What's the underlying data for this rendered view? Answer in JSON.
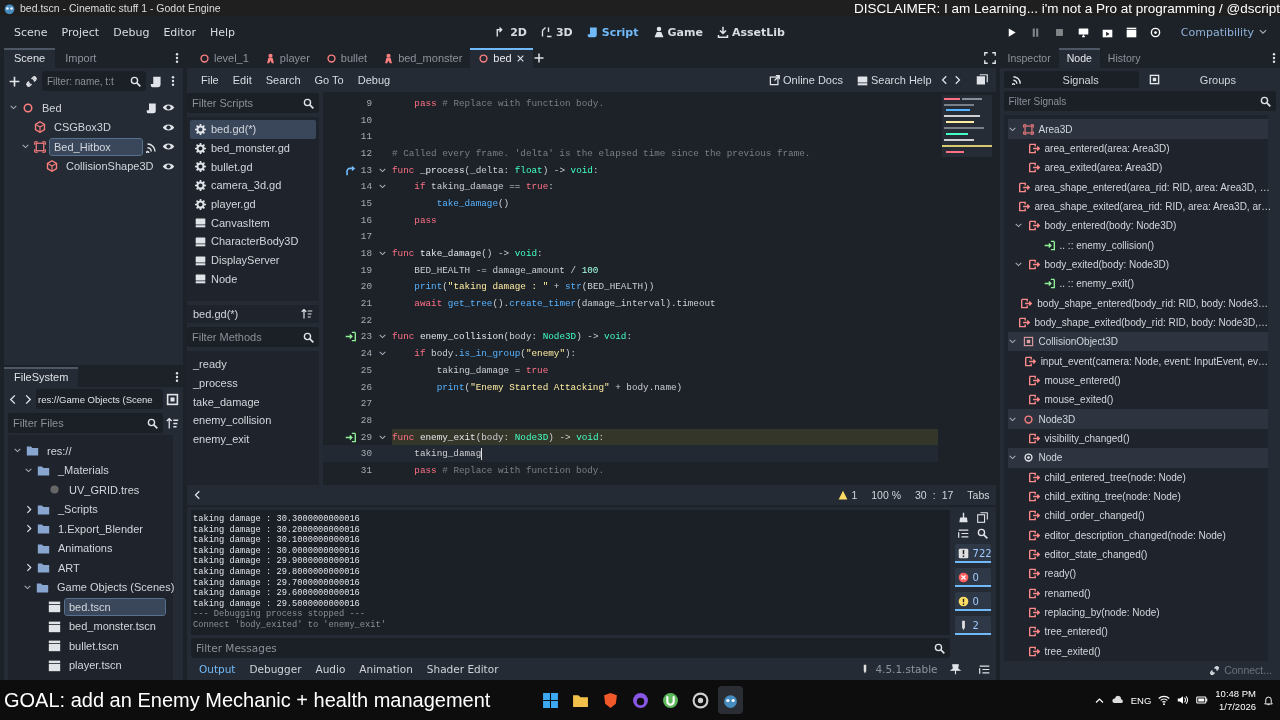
{
  "window": {
    "title": "bed.tscn - Cinematic stuff 1 - Godot Engine"
  },
  "overlay_text": "DISCLAIMER: I am Learning... i'm not a Pro at programming / @dscript",
  "menu": [
    "Scene",
    "Project",
    "Debug",
    "Editor",
    "Help"
  ],
  "workspaces": [
    {
      "label": "2D",
      "kind": "flat",
      "selected": false
    },
    {
      "label": "3D",
      "kind": "spatial",
      "selected": false
    },
    {
      "label": "Script",
      "kind": "script",
      "selected": true
    },
    {
      "label": "Game",
      "kind": "game",
      "selected": false
    },
    {
      "label": "AssetLib",
      "kind": "assetlib",
      "selected": false
    }
  ],
  "run_buttons": [
    {
      "kind": "play",
      "disabled": false
    },
    {
      "kind": "pause",
      "disabled": true
    },
    {
      "kind": "stop",
      "disabled": true
    },
    {
      "kind": "remote",
      "disabled": false
    },
    {
      "kind": "scene",
      "disabled": false
    },
    {
      "kind": "custom",
      "disabled": false
    },
    {
      "kind": "movie",
      "disabled": false
    }
  ],
  "renderer": "Compatibility",
  "scene_dock": {
    "tabs": [
      {
        "label": "Scene",
        "selected": true
      },
      {
        "label": "Import",
        "selected": false
      }
    ],
    "filter": {
      "placeholder": "Filter: name, t:t"
    },
    "tree": [
      {
        "label": "Bed",
        "kind": "node3d",
        "has_script": true,
        "has_signals": false,
        "visible": true,
        "selected": false,
        "expanded": true,
        "children": [
          {
            "label": "CSGBox3D",
            "kind": "csg",
            "has_script": false,
            "has_signals": false,
            "visible": true,
            "selected": false
          },
          {
            "label": "Bed_Hitbox",
            "kind": "area",
            "has_script": false,
            "has_signals": true,
            "visible": true,
            "selected": true,
            "expanded": true,
            "children": [
              {
                "label": "CollisionShape3D",
                "kind": "shape",
                "has_script": false,
                "has_signals": false,
                "visible": true,
                "selected": false
              }
            ]
          }
        ]
      }
    ]
  },
  "filesystem": {
    "title": "FileSystem",
    "path": "res://Game Objects (Scene",
    "filter": {
      "placeholder": "Filter Files"
    },
    "tree": [
      {
        "label": "res://",
        "kind": "folder",
        "expanded": true,
        "selected": false,
        "children": [
          {
            "label": "_Materials",
            "kind": "folder",
            "expanded": true,
            "selected": false,
            "children": [
              {
                "label": "UV_GRID.tres",
                "kind": "resource",
                "selected": false
              }
            ]
          },
          {
            "label": "_Scripts",
            "kind": "folder",
            "expanded": false,
            "selected": false
          },
          {
            "label": "1.Export_Blender",
            "kind": "folder",
            "expanded": false,
            "selected": false
          },
          {
            "label": "Animations",
            "kind": "folder",
            "selected": false
          },
          {
            "label": "ART",
            "kind": "folder",
            "expanded": false,
            "selected": false
          },
          {
            "label": "Game Objects (Scenes)",
            "kind": "folder",
            "expanded": true,
            "selected": false,
            "children": [
              {
                "label": "bed.tscn",
                "kind": "scene",
                "selected": true
              },
              {
                "label": "bed_monster.tscn",
                "kind": "scene",
                "selected": false
              },
              {
                "label": "bullet.tscn",
                "kind": "scene",
                "selected": false
              },
              {
                "label": "player.tscn",
                "kind": "scene",
                "selected": false
              }
            ]
          }
        ]
      }
    ]
  },
  "editor_tabs": [
    {
      "label": "level_1",
      "kind": "node3d",
      "selected": false
    },
    {
      "label": "player",
      "kind": "character",
      "selected": false
    },
    {
      "label": "bullet",
      "kind": "node3d",
      "selected": false
    },
    {
      "label": "bed_monster",
      "kind": "character",
      "selected": false
    },
    {
      "label": "bed",
      "kind": "node3d",
      "selected": true
    }
  ],
  "script_menu": [
    "File",
    "Edit",
    "Search",
    "Go To",
    "Debug"
  ],
  "help_links": [
    {
      "label": "Online Docs",
      "kind": "docs"
    },
    {
      "label": "Search Help",
      "kind": "help"
    }
  ],
  "scripts": {
    "filter": {
      "placeholder": "Filter Scripts"
    },
    "items": [
      {
        "label": "bed.gd(*)",
        "kind": "script",
        "selected": true
      },
      {
        "label": "bed_monster.gd",
        "kind": "script",
        "selected": false
      },
      {
        "label": "bullet.gd",
        "kind": "script",
        "selected": false
      },
      {
        "label": "camera_3d.gd",
        "kind": "script",
        "selected": false
      },
      {
        "label": "player.gd",
        "kind": "script",
        "selected": false
      },
      {
        "label": "CanvasItem",
        "kind": "doc",
        "selected": false
      },
      {
        "label": "CharacterBody3D",
        "kind": "doc",
        "selected": false
      },
      {
        "label": "DisplayServer",
        "kind": "doc",
        "selected": false
      },
      {
        "label": "Node",
        "kind": "doc",
        "selected": false
      }
    ],
    "current": "bed.gd(*)"
  },
  "methods": {
    "filter": {
      "placeholder": "Filter Methods"
    },
    "items": [
      "_ready",
      "_process",
      "take_damage",
      "enemy_collision",
      "enemy_exit"
    ]
  },
  "code": {
    "lines": [
      {
        "n": "9",
        "kind": "plain",
        "fold": false,
        "marked": false,
        "current": false,
        "caret": false,
        "tokens": [
          {
            "kind": "kw",
            "text": "    pass"
          },
          {
            "kind": "comment",
            "text": " # Replace with function body."
          }
        ]
      },
      {
        "n": "10",
        "kind": "plain",
        "fold": false,
        "marked": false,
        "current": false,
        "caret": false
      },
      {
        "n": "11",
        "kind": "plain",
        "fold": false,
        "marked": false,
        "current": false,
        "caret": false
      },
      {
        "n": "12",
        "kind": "plain",
        "fold": false,
        "marked": false,
        "current": false,
        "caret": false,
        "tokens": [
          {
            "kind": "comment",
            "text": "# Called every frame. 'delta' is the elapsed time since the previous frame."
          }
        ]
      },
      {
        "n": "13",
        "kind": "override",
        "fold": true,
        "marked": false,
        "current": false,
        "caret": false,
        "tokens": [
          {
            "kind": "kw",
            "text": "func"
          },
          {
            "kind": "name",
            "text": " _process"
          },
          {
            "kind": "plain",
            "text": "(_delta: "
          },
          {
            "kind": "type",
            "text": "float"
          },
          {
            "kind": "plain",
            "text": ") -> "
          },
          {
            "kind": "type",
            "text": "void"
          },
          {
            "kind": "plain",
            "text": ":"
          }
        ]
      },
      {
        "n": "14",
        "kind": "plain",
        "fold": true,
        "marked": false,
        "current": false,
        "caret": false,
        "tokens": [
          {
            "kind": "kw",
            "text": "    if"
          },
          {
            "kind": "plain",
            "text": " taking_damage == "
          },
          {
            "kind": "kw",
            "text": "true"
          },
          {
            "kind": "plain",
            "text": ":"
          }
        ]
      },
      {
        "n": "15",
        "kind": "plain",
        "fold": false,
        "marked": false,
        "current": false,
        "caret": false,
        "tokens": [
          {
            "kind": "call",
            "text": "        take_damage"
          },
          {
            "kind": "plain",
            "text": "()"
          }
        ]
      },
      {
        "n": "16",
        "kind": "plain",
        "fold": false,
        "marked": false,
        "current": false,
        "caret": false,
        "tokens": [
          {
            "kind": "kw",
            "text": "    pass"
          }
        ]
      },
      {
        "n": "17",
        "kind": "plain",
        "fold": false,
        "marked": false,
        "current": false,
        "caret": false
      },
      {
        "n": "18",
        "kind": "plain",
        "fold": true,
        "marked": false,
        "current": false,
        "caret": false,
        "tokens": [
          {
            "kind": "kw",
            "text": "func"
          },
          {
            "kind": "name",
            "text": " take_damage"
          },
          {
            "kind": "plain",
            "text": "() -> "
          },
          {
            "kind": "type",
            "text": "void"
          },
          {
            "kind": "plain",
            "text": ":"
          }
        ]
      },
      {
        "n": "19",
        "kind": "plain",
        "fold": false,
        "marked": false,
        "current": false,
        "caret": false,
        "tokens": [
          {
            "kind": "plain",
            "text": "    BED_HEALTH -= damage_amount / "
          },
          {
            "kind": "num",
            "text": "100"
          }
        ]
      },
      {
        "n": "20",
        "kind": "plain",
        "fold": false,
        "marked": false,
        "current": false,
        "caret": false,
        "tokens": [
          {
            "kind": "call",
            "text": "    print"
          },
          {
            "kind": "plain",
            "text": "("
          },
          {
            "kind": "str",
            "text": "\"taking damage : \""
          },
          {
            "kind": "plain",
            "text": " + "
          },
          {
            "kind": "call",
            "text": "str"
          },
          {
            "kind": "plain",
            "text": "(BED_HEALTH))"
          }
        ]
      },
      {
        "n": "21",
        "kind": "plain",
        "fold": false,
        "marked": false,
        "current": false,
        "caret": false,
        "tokens": [
          {
            "kind": "kw",
            "text": "    await "
          },
          {
            "kind": "call",
            "text": "get_tree"
          },
          {
            "kind": "plain",
            "text": "()."
          },
          {
            "kind": "call",
            "text": "create_timer"
          },
          {
            "kind": "plain",
            "text": "(damage_interval).timeout"
          }
        ]
      },
      {
        "n": "22",
        "kind": "plain",
        "fold": false,
        "marked": false,
        "current": false,
        "caret": false
      },
      {
        "n": "23",
        "kind": "connected",
        "fold": true,
        "marked": false,
        "current": false,
        "caret": false,
        "tokens": [
          {
            "kind": "kw",
            "text": "func"
          },
          {
            "kind": "name",
            "text": " enemy_collision"
          },
          {
            "kind": "plain",
            "text": "(body: "
          },
          {
            "kind": "type",
            "text": "Node3D"
          },
          {
            "kind": "plain",
            "text": ") -> "
          },
          {
            "kind": "type",
            "text": "void"
          },
          {
            "kind": "plain",
            "text": ":"
          }
        ]
      },
      {
        "n": "24",
        "kind": "plain",
        "fold": true,
        "marked": false,
        "current": false,
        "caret": false,
        "tokens": [
          {
            "kind": "kw",
            "text": "    if"
          },
          {
            "kind": "plain",
            "text": " body."
          },
          {
            "kind": "call",
            "text": "is_in_group"
          },
          {
            "kind": "plain",
            "text": "("
          },
          {
            "kind": "str",
            "text": "\"enemy\""
          },
          {
            "kind": "plain",
            "text": "):"
          }
        ]
      },
      {
        "n": "25",
        "kind": "plain",
        "fold": false,
        "marked": false,
        "current": false,
        "caret": false,
        "tokens": [
          {
            "kind": "plain",
            "text": "        taking_damage = "
          },
          {
            "kind": "kw",
            "text": "true"
          }
        ]
      },
      {
        "n": "26",
        "kind": "plain",
        "fold": false,
        "marked": false,
        "current": false,
        "caret": false,
        "tokens": [
          {
            "kind": "call",
            "text": "        print"
          },
          {
            "kind": "plain",
            "text": "("
          },
          {
            "kind": "str",
            "text": "\"Enemy Started Attacking\""
          },
          {
            "kind": "plain",
            "text": " + body.name)"
          }
        ]
      },
      {
        "n": "27",
        "kind": "plain",
        "fold": false,
        "marked": false,
        "current": false,
        "caret": false
      },
      {
        "n": "28",
        "kind": "plain",
        "fold": false,
        "marked": false,
        "current": false,
        "caret": false
      },
      {
        "n": "29",
        "kind": "connected",
        "fold": true,
        "marked": true,
        "current": false,
        "caret": false,
        "tokens": [
          {
            "kind": "kw",
            "text": "func"
          },
          {
            "kind": "name",
            "text": " enemy_exit"
          },
          {
            "kind": "plain",
            "text": "(body: "
          },
          {
            "kind": "type",
            "text": "Node3D"
          },
          {
            "kind": "plain",
            "text": ") -> "
          },
          {
            "kind": "type",
            "text": "void"
          },
          {
            "kind": "plain",
            "text": ":"
          }
        ]
      },
      {
        "n": "30",
        "kind": "plain",
        "fold": false,
        "marked": false,
        "current": true,
        "caret": true,
        "tokens": [
          {
            "kind": "plain",
            "text": "    taking_damag"
          }
        ]
      },
      {
        "n": "31",
        "kind": "plain",
        "fold": false,
        "marked": false,
        "current": false,
        "caret": false,
        "tokens": [
          {
            "kind": "kw",
            "text": "    pass"
          },
          {
            "kind": "comment",
            "text": " # Replace with function body."
          }
        ]
      }
    ]
  },
  "status": {
    "warnings": "1",
    "zoom": "100 %",
    "line": "30",
    "separator": ":",
    "column": "17",
    "indent": "Tabs"
  },
  "output": {
    "lines": [
      {
        "kind": "log",
        "text": "taking damage : 30.3000000000016"
      },
      {
        "kind": "log",
        "text": "taking damage : 30.2000000000016"
      },
      {
        "kind": "log",
        "text": "taking damage : 30.1000000000016"
      },
      {
        "kind": "log",
        "text": "taking damage : 30.0000000000016"
      },
      {
        "kind": "log",
        "text": "taking damage : 29.9000000000016"
      },
      {
        "kind": "log",
        "text": "taking damage : 29.8000000000016"
      },
      {
        "kind": "log",
        "text": "taking damage : 29.7000000000016"
      },
      {
        "kind": "log",
        "text": "taking damage : 29.6000000000016"
      },
      {
        "kind": "log",
        "text": "taking damage : 29.5000000000016"
      },
      {
        "kind": "info",
        "text": "--- Debugging process stopped ---"
      },
      {
        "kind": "info",
        "text": "Connect 'body_exited' to 'enemy_exit'"
      }
    ],
    "filter": {
      "placeholder": "Filter Messages"
    },
    "counters": [
      {
        "kind": "message",
        "count": "722",
        "on": true
      },
      {
        "kind": "error",
        "count": "0",
        "on": true
      },
      {
        "kind": "warning",
        "count": "0",
        "on": true
      },
      {
        "kind": "editor",
        "count": "2",
        "on": true
      }
    ],
    "tabs": [
      {
        "label": "Output",
        "selected": true
      },
      {
        "label": "Debugger",
        "selected": false
      },
      {
        "label": "Audio",
        "selected": false
      },
      {
        "label": "Animation",
        "selected": false
      },
      {
        "label": "Shader Editor",
        "selected": false
      }
    ],
    "version": "4.5.1.stable"
  },
  "node_dock": {
    "tabs": [
      {
        "label": "Inspector",
        "selected": false
      },
      {
        "label": "Node",
        "selected": true
      },
      {
        "label": "History",
        "selected": false
      }
    ],
    "modes": [
      {
        "label": "Signals",
        "kind": "signals",
        "selected": true
      },
      {
        "label": "Groups",
        "kind": "groups",
        "selected": false
      }
    ],
    "filter": {
      "placeholder": "Filter Signals"
    },
    "classes": [
      {
        "label": "Area3D",
        "kind": "area",
        "expanded": true,
        "signals": [
          {
            "label": "area_entered(area: Area3D)"
          },
          {
            "label": "area_exited(area: Area3D)"
          },
          {
            "label": "area_shape_entered(area_rid: RID, area: Area3D, …"
          },
          {
            "label": "area_shape_exited(area_rid: RID, area: Area3D, ar…"
          },
          {
            "label": "body_entered(body: Node3D)",
            "expanded": true,
            "connections": [
              ".. :: enemy_collision()"
            ]
          },
          {
            "label": "body_exited(body: Node3D)",
            "expanded": true,
            "connections": [
              ".. :: enemy_exit()"
            ]
          },
          {
            "label": "body_shape_entered(body_rid: RID, body: Node3…"
          },
          {
            "label": "body_shape_exited(body_rid: RID, body: Node3D,…"
          }
        ]
      },
      {
        "label": "CollisionObject3D",
        "kind": "collision",
        "expanded": true,
        "signals": [
          {
            "label": "input_event(camera: Node, event: InputEvent, ev…"
          },
          {
            "label": "mouse_entered()"
          },
          {
            "label": "mouse_exited()"
          }
        ]
      },
      {
        "label": "Node3D",
        "kind": "node3d",
        "expanded": true,
        "signals": [
          {
            "label": "visibility_changed()"
          }
        ]
      },
      {
        "label": "Node",
        "kind": "node",
        "expanded": true,
        "signals": [
          {
            "label": "child_entered_tree(node: Node)"
          },
          {
            "label": "child_exiting_tree(node: Node)"
          },
          {
            "label": "child_order_changed()"
          },
          {
            "label": "editor_description_changed(node: Node)"
          },
          {
            "label": "editor_state_changed()"
          },
          {
            "label": "ready()"
          },
          {
            "label": "renamed()"
          },
          {
            "label": "replacing_by(node: Node)"
          },
          {
            "label": "tree_entered()"
          },
          {
            "label": "tree_exited()"
          }
        ]
      }
    ],
    "connect_button": {
      "label": "Connect...",
      "disabled": true
    }
  },
  "caption": "GOAL: add an Enemy Mechanic + health management",
  "taskbar": [
    {
      "kind": "start",
      "selected": false
    },
    {
      "kind": "folder",
      "selected": false
    },
    {
      "kind": "shield",
      "selected": false
    },
    {
      "kind": "cat",
      "selected": false
    },
    {
      "kind": "leaf",
      "selected": false
    },
    {
      "kind": "ring",
      "selected": false
    },
    {
      "kind": "robot",
      "selected": true
    }
  ],
  "tray": {
    "language": "ENG",
    "time": "10:48 PM",
    "date": "1/7/2026"
  }
}
